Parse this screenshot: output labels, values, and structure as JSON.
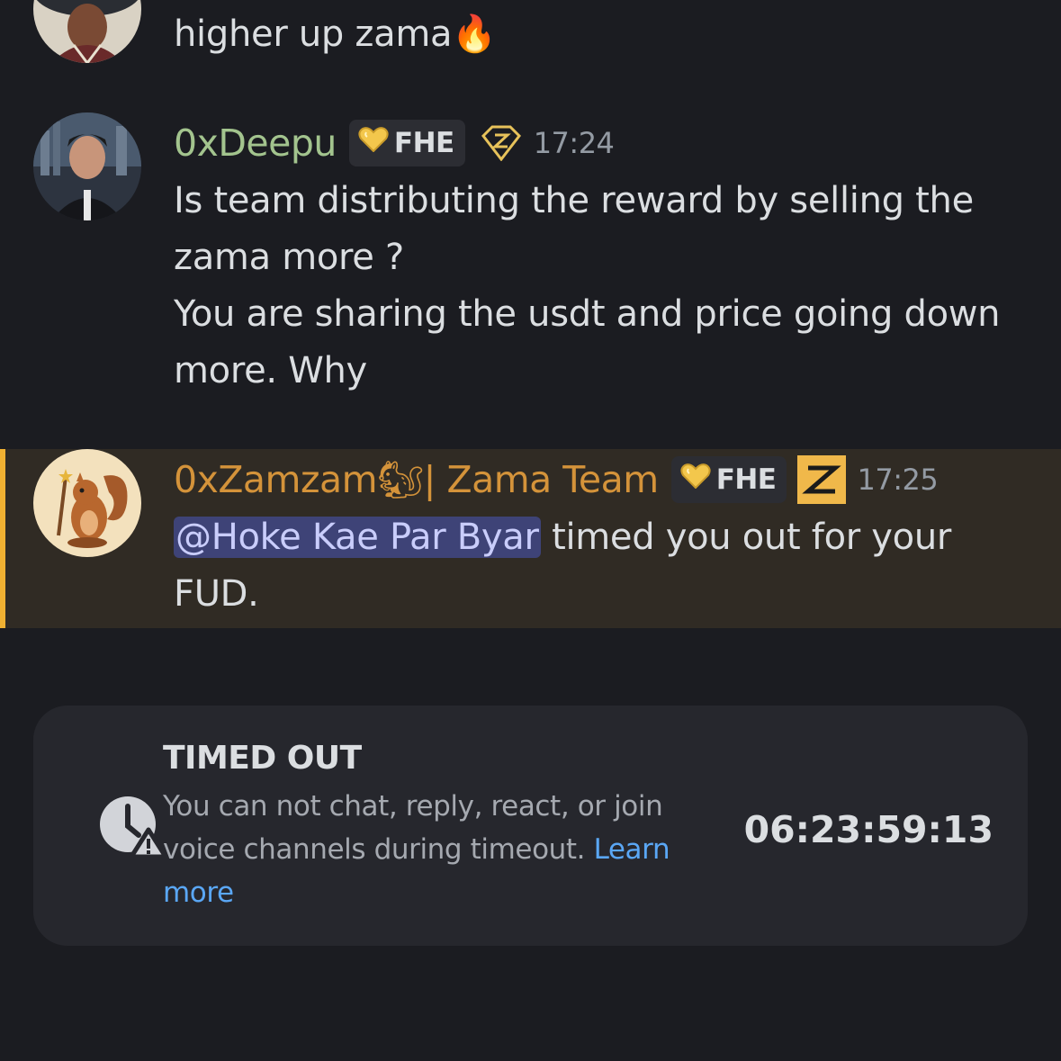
{
  "messages": [
    {
      "id": "prev",
      "text": "higher up zama",
      "emoji": "🔥"
    },
    {
      "id": "deepu",
      "username": "0xDeepu",
      "username_color": "#a3c48e",
      "role_badge": "FHE",
      "badge_icon": "diamond-z-icon",
      "timestamp": "17:24",
      "lines": [
        "Is team distributing the reward by selling the",
        "zama more ?",
        "You are sharing the usdt and price going down",
        "more. Why"
      ]
    },
    {
      "id": "zamzam",
      "username": "0xZamzam",
      "username_emoji": "🐿",
      "username_suffix": "| Zama Team",
      "username_color": "#d4933a",
      "role_badge": "FHE",
      "badge_icon": "zama-z-icon",
      "timestamp": "17:25",
      "mention": "@Hoke Kae Par Byar",
      "text_after_mention": " timed you out for your",
      "line2": "FUD.",
      "highlighted": true,
      "highlight_color": "#f0b132"
    }
  ],
  "timeout": {
    "title": "TIMED OUT",
    "description": "You can not chat, reply, react, or join voice channels during timeout.",
    "link": "Learn more",
    "countdown": "06:23:59:13",
    "icon": "clock-warning-icon"
  }
}
